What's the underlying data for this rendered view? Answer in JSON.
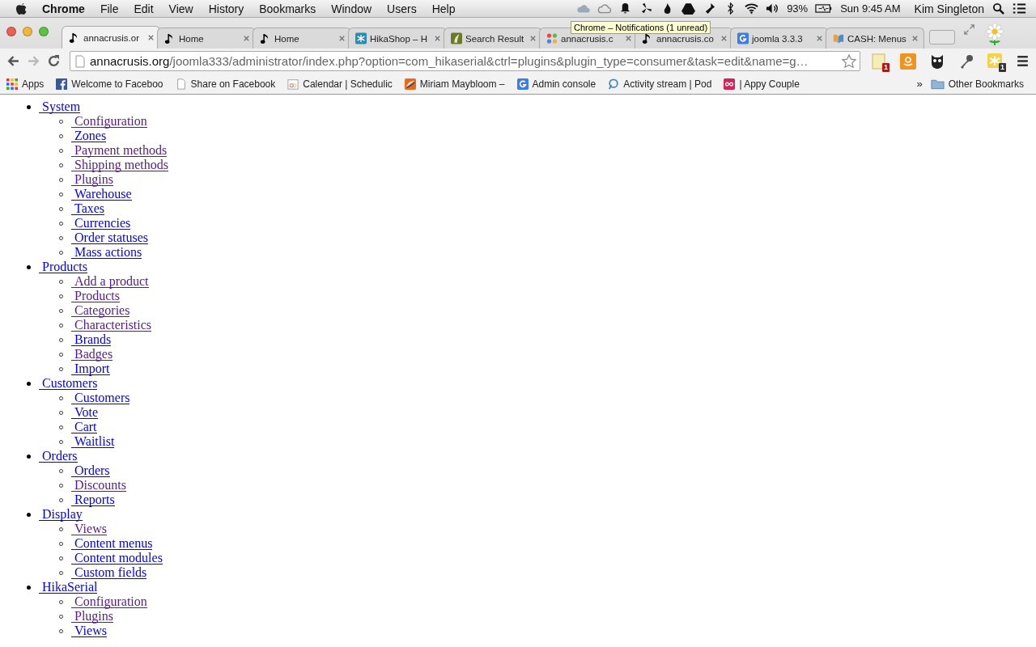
{
  "menubar": {
    "app": "Chrome",
    "items": [
      "File",
      "Edit",
      "View",
      "History",
      "Bookmarks",
      "Window",
      "Users",
      "Help"
    ],
    "battery": "93%",
    "clock": "Sun 9:45 AM",
    "user": "Kim Singleton"
  },
  "tabs": [
    {
      "title": "annacrusis.or",
      "kind": "note",
      "selected": true
    },
    {
      "title": "Home",
      "kind": "note",
      "selected": false
    },
    {
      "title": "Home",
      "kind": "note",
      "selected": false
    },
    {
      "title": "HikaShop – H",
      "kind": "star",
      "selected": false
    },
    {
      "title": "Search Result",
      "kind": "leaf",
      "selected": false
    },
    {
      "title": "annacrusis.c",
      "kind": "joomla",
      "selected": false
    },
    {
      "title": "annacrusis.co",
      "kind": "note",
      "selected": false
    },
    {
      "title": "joomla 3.3.3",
      "kind": "google",
      "selected": false
    },
    {
      "title": "CASH: Menus",
      "kind": "book",
      "selected": false
    }
  ],
  "tooltip": "Chrome – Notifications (1 unread)",
  "address": {
    "host": "annacrusis.org",
    "path": "/joomla333/administrator/index.php?option=com_hikaserial&ctrl=plugins&plugin_type=consumer&task=edit&name=g…"
  },
  "extensions": [
    {
      "kind": "note",
      "badge": "1"
    },
    {
      "kind": "amazon"
    },
    {
      "kind": "owl"
    },
    {
      "kind": "key"
    },
    {
      "kind": "puzzle",
      "badge": "1"
    }
  ],
  "bookmarks": [
    {
      "label": "Apps",
      "kind": "apps"
    },
    {
      "label": "Welcome to Faceboo",
      "kind": "facebook"
    },
    {
      "label": "Share on Facebook",
      "kind": "page"
    },
    {
      "label": "Calendar | Schedulic",
      "kind": "calendar"
    },
    {
      "label": "Miriam Maybloom –",
      "kind": "swirl"
    },
    {
      "label": "Admin console",
      "kind": "google"
    },
    {
      "label": "Activity stream | Pod",
      "kind": "pin"
    },
    {
      "label": "| Appy Couple",
      "kind": "infinity"
    }
  ],
  "bookmarks_overflow": "»",
  "other_bookmarks": "Other Bookmarks",
  "menu": [
    {
      "label": "System",
      "visited": false,
      "children": [
        {
          "label": "Configuration",
          "visited": true
        },
        {
          "label": "Zones",
          "visited": false
        },
        {
          "label": "Payment methods",
          "visited": true
        },
        {
          "label": "Shipping methods",
          "visited": true
        },
        {
          "label": "Plugins",
          "visited": true
        },
        {
          "label": "Warehouse",
          "visited": false
        },
        {
          "label": "Taxes",
          "visited": false
        },
        {
          "label": "Currencies",
          "visited": false
        },
        {
          "label": "Order statuses",
          "visited": false
        },
        {
          "label": "Mass actions",
          "visited": false
        }
      ]
    },
    {
      "label": "Products",
      "visited": false,
      "children": [
        {
          "label": "Add a product",
          "visited": true
        },
        {
          "label": "Products",
          "visited": true
        },
        {
          "label": "Categories",
          "visited": true
        },
        {
          "label": "Characteristics",
          "visited": true
        },
        {
          "label": "Brands",
          "visited": false
        },
        {
          "label": "Badges",
          "visited": true
        },
        {
          "label": "Import",
          "visited": false
        }
      ]
    },
    {
      "label": "Customers",
      "visited": false,
      "children": [
        {
          "label": "Customers",
          "visited": false
        },
        {
          "label": "Vote",
          "visited": false
        },
        {
          "label": "Cart",
          "visited": false
        },
        {
          "label": "Waitlist",
          "visited": false
        }
      ]
    },
    {
      "label": "Orders",
      "visited": false,
      "children": [
        {
          "label": "Orders",
          "visited": false
        },
        {
          "label": "Discounts",
          "visited": true
        },
        {
          "label": "Reports",
          "visited": false
        }
      ]
    },
    {
      "label": "Display",
      "visited": false,
      "children": [
        {
          "label": "Views",
          "visited": true
        },
        {
          "label": "Content menus",
          "visited": false
        },
        {
          "label": "Content modules",
          "visited": false
        },
        {
          "label": "Custom fields",
          "visited": false
        }
      ]
    },
    {
      "label": "HikaSerial",
      "visited": false,
      "children": [
        {
          "label": "Configuration",
          "visited": true
        },
        {
          "label": "Plugins",
          "visited": true
        },
        {
          "label": "Views",
          "visited": false
        }
      ]
    }
  ]
}
